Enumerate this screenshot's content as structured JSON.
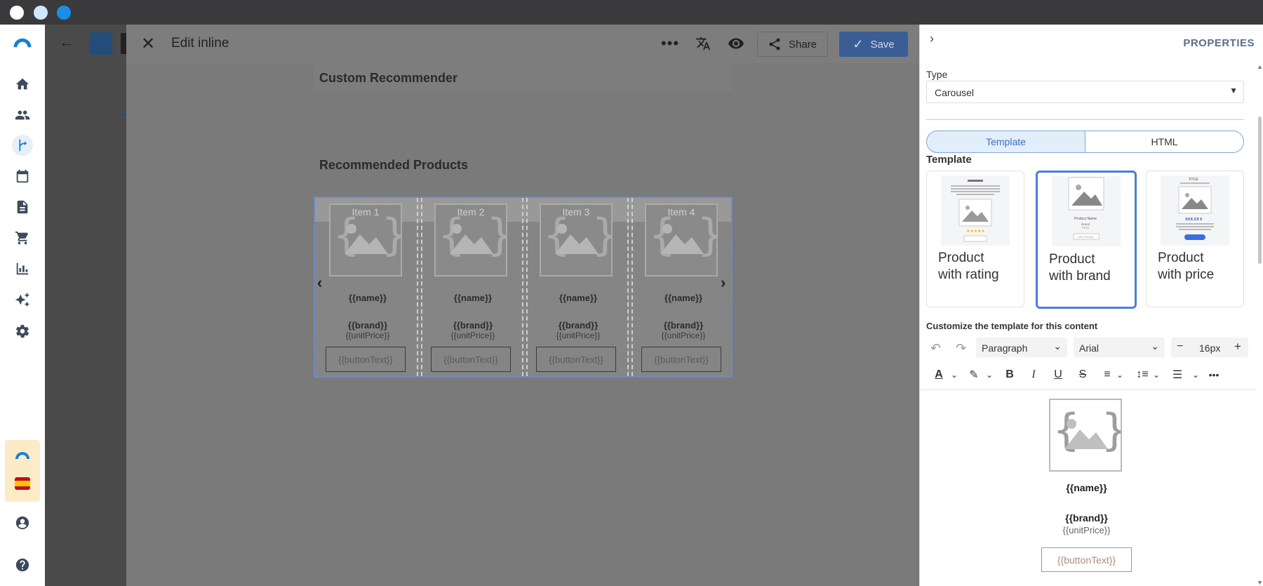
{
  "editor": {
    "title": "Edit inline",
    "share_label": "Share",
    "save_label": "Save"
  },
  "canvas": {
    "header_title": "Custom Recommender",
    "section_title": "Recommended Products",
    "items": [
      {
        "label": "Item 1",
        "name": "{{name}}",
        "brand": "{{brand}}",
        "price": "{{unitPrice}}",
        "button": "{{buttonText}}"
      },
      {
        "label": "Item 2",
        "name": "{{name}}",
        "brand": "{{brand}}",
        "price": "{{unitPrice}}",
        "button": "{{buttonText}}"
      },
      {
        "label": "Item 3",
        "name": "{{name}}",
        "brand": "{{brand}}",
        "price": "{{unitPrice}}",
        "button": "{{buttonText}}"
      },
      {
        "label": "Item 4",
        "name": "{{name}}",
        "brand": "{{brand}}",
        "price": "{{unitPrice}}",
        "button": "{{buttonText}}"
      }
    ]
  },
  "properties": {
    "heading": "PROPERTIES",
    "type_label": "Type",
    "type_value": "Carousel",
    "tabs": [
      "Template",
      "HTML"
    ],
    "active_tab": "Template",
    "template_label": "Template",
    "templates": [
      {
        "line1": "Product",
        "line2": "with rating",
        "selected": false
      },
      {
        "line1": "Product",
        "line2": "with brand",
        "selected": true
      },
      {
        "line1": "Product",
        "line2": "with price",
        "selected": false
      }
    ],
    "customize_label": "Customize the template for this content",
    "toolbar": {
      "block_format": "Paragraph",
      "font": "Arial",
      "font_size": "16px"
    },
    "preview": {
      "name": "{{name}}",
      "brand": "{{brand}}",
      "price": "{{unitPrice}}",
      "button": "{{buttonText}}"
    }
  },
  "colors": {
    "accent": "#4a7fd9",
    "titlebar": "#3a3a3d",
    "overlay": "#7a7a7a",
    "dot1": "#ffffff",
    "dot2": "#cfe7fb",
    "dot3": "#1a8fe8"
  }
}
